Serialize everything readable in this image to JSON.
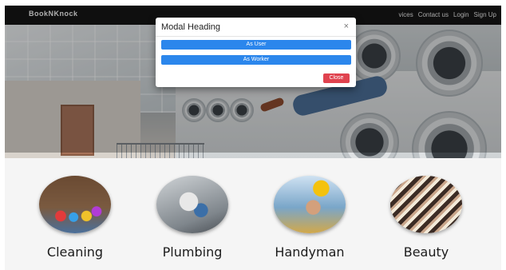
{
  "navbar": {
    "brand": "BookNKnock",
    "links": [
      "vices",
      "Contact us",
      "Login",
      "Sign Up"
    ]
  },
  "modal": {
    "title": "Modal Heading",
    "close_icon": "×",
    "user_button": "As User",
    "worker_button": "As Worker",
    "close_button": "Close"
  },
  "services": [
    {
      "label": "Cleaning"
    },
    {
      "label": "Plumbing"
    },
    {
      "label": "Handyman"
    },
    {
      "label": "Beauty"
    }
  ],
  "colors": {
    "primary": "#2b86ec",
    "danger": "#e0434f",
    "navbar": "#151515"
  }
}
